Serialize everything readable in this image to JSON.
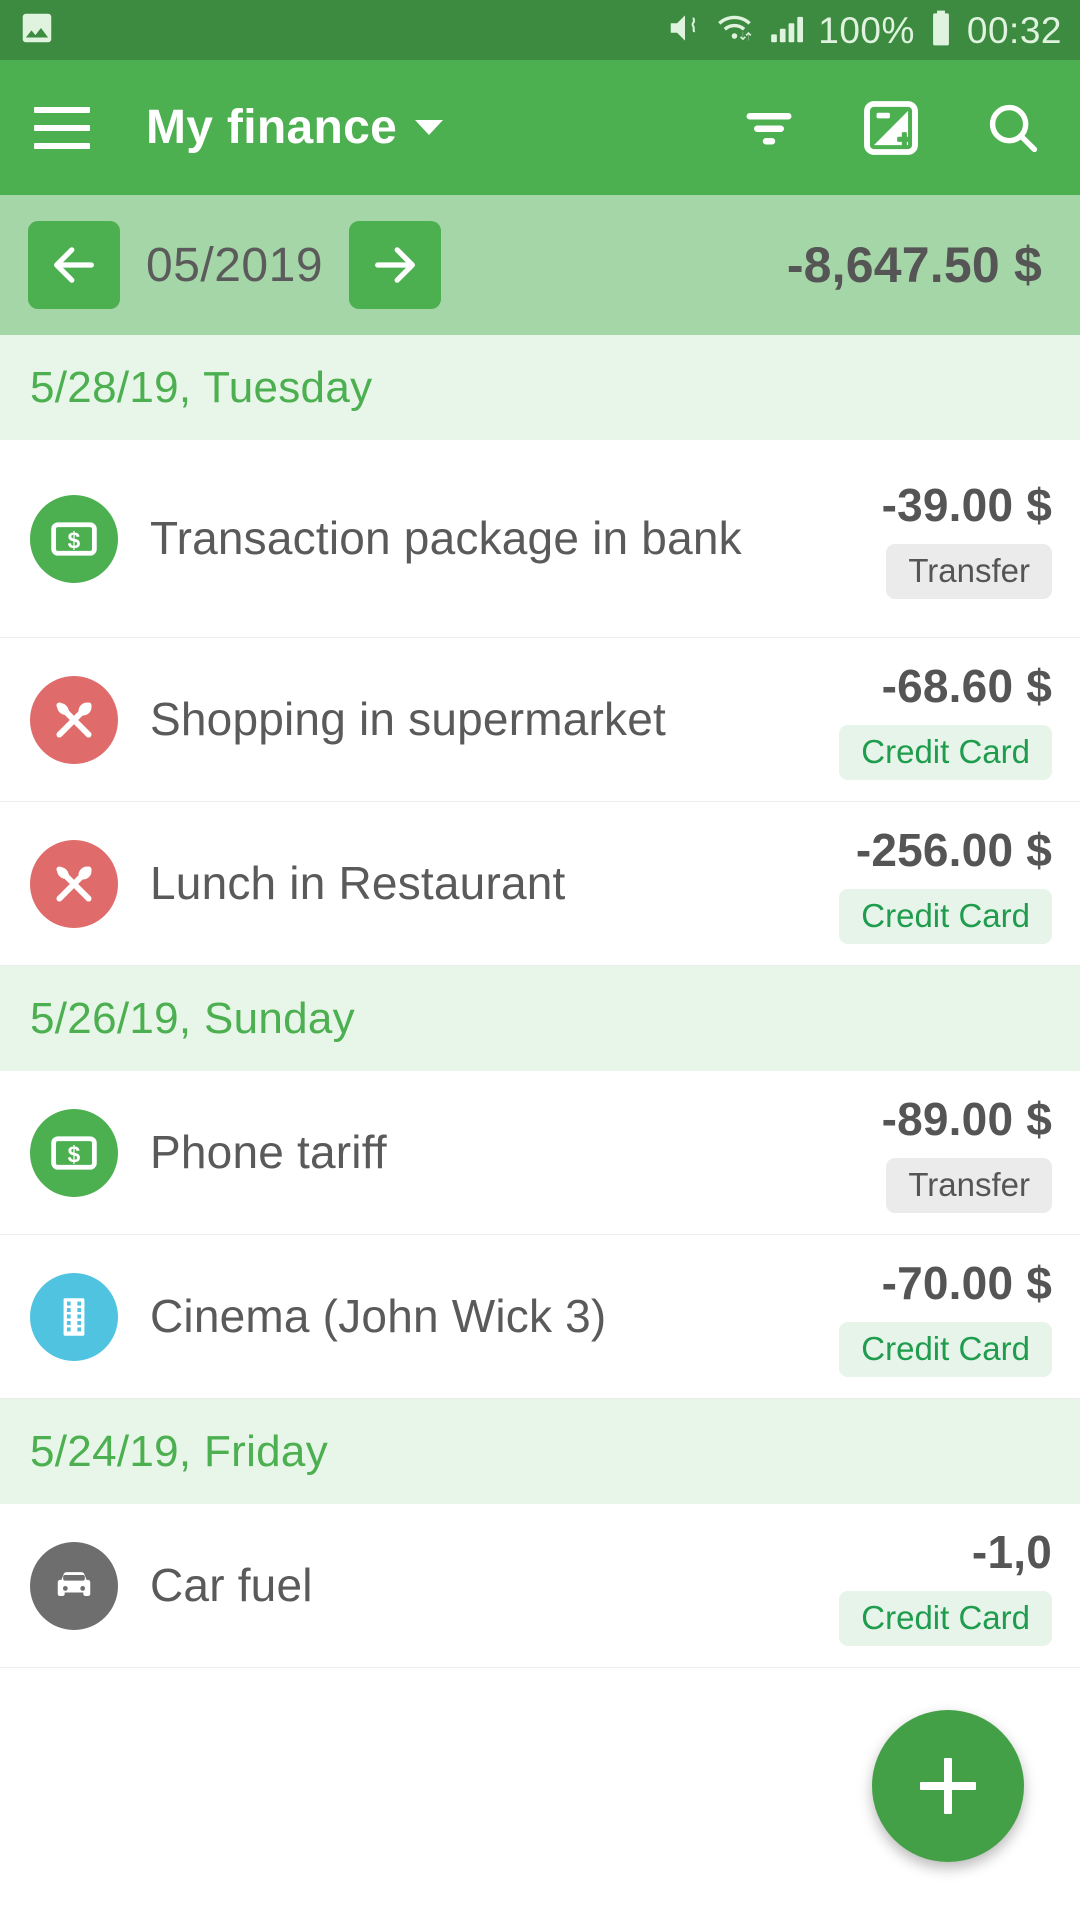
{
  "status_bar": {
    "icons": [
      "image-icon",
      "mute-vibrate-icon",
      "wifi-icon",
      "signal-icon"
    ],
    "battery_percent": "100%",
    "time": "00:32"
  },
  "app_bar": {
    "menu_icon": "hamburger-menu-icon",
    "title": "My finance",
    "dropdown_icon": "chevron-down-icon",
    "actions": [
      {
        "name": "filter-icon",
        "label": "Filter"
      },
      {
        "name": "add-template-icon",
        "label": "Add template"
      },
      {
        "name": "search-icon",
        "label": "Search"
      }
    ]
  },
  "month_bar": {
    "prev_icon": "arrow-left-icon",
    "next_icon": "arrow-right-icon",
    "period": "05/2019",
    "total": "-8,647.50 $"
  },
  "groups": [
    {
      "date": "5/28/19, Tuesday",
      "transactions": [
        {
          "icon": "banknote-icon",
          "icon_color": "#4caf50",
          "title": "Transaction package in bank",
          "amount": "-39.00 $",
          "badge": "Transfer",
          "badge_type": "transfer"
        },
        {
          "icon": "cutlery-icon",
          "icon_color": "#e06b6b",
          "title": "Shopping in supermarket",
          "amount": "-68.60 $",
          "badge": "Credit Card",
          "badge_type": "credit"
        },
        {
          "icon": "cutlery-icon",
          "icon_color": "#e06b6b",
          "title": "Lunch in Restaurant",
          "amount": "-256.00 $",
          "badge": "Credit Card",
          "badge_type": "credit"
        }
      ]
    },
    {
      "date": "5/26/19, Sunday",
      "transactions": [
        {
          "icon": "banknote-icon",
          "icon_color": "#4caf50",
          "title": "Phone tariff",
          "amount": "-89.00 $",
          "badge": "Transfer",
          "badge_type": "transfer"
        },
        {
          "icon": "film-icon",
          "icon_color": "#4fc3e0",
          "title": "Cinema (John Wick 3)",
          "amount": "-70.00 $",
          "badge": "Credit Card",
          "badge_type": "credit"
        }
      ]
    },
    {
      "date": "5/24/19, Friday",
      "transactions": [
        {
          "icon": "car-icon",
          "icon_color": "#6e6e6e",
          "title": "Car fuel",
          "amount": "-1,0",
          "badge": "Credit Card",
          "badge_type": "credit"
        }
      ]
    }
  ],
  "fab": {
    "icon": "plus-icon",
    "color": "#43a047"
  }
}
